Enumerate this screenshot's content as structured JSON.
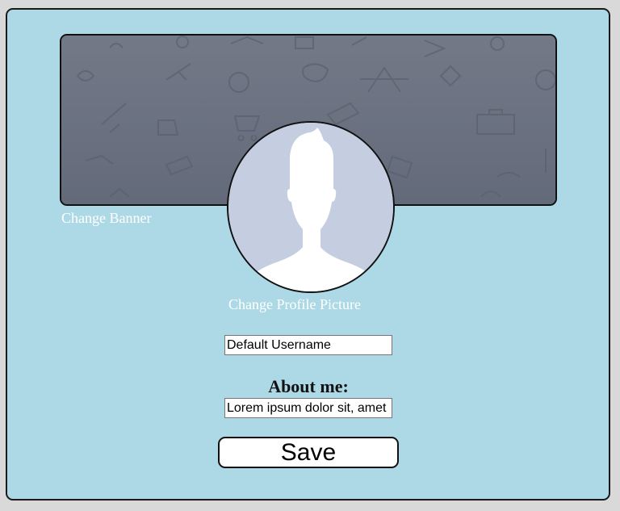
{
  "banner": {
    "change_label": "Change Banner"
  },
  "profile": {
    "change_picture_label": "Change Profile Picture"
  },
  "username": {
    "value": "Default Username"
  },
  "about": {
    "label": "About me:",
    "value": "Lorem ipsum dolor sit, amet"
  },
  "actions": {
    "save_label": "Save"
  },
  "colors": {
    "page_background": "#add8e6",
    "banner_background": "#6b7180",
    "avatar_background": "#c5cde0",
    "link_text": "#ffffff"
  }
}
